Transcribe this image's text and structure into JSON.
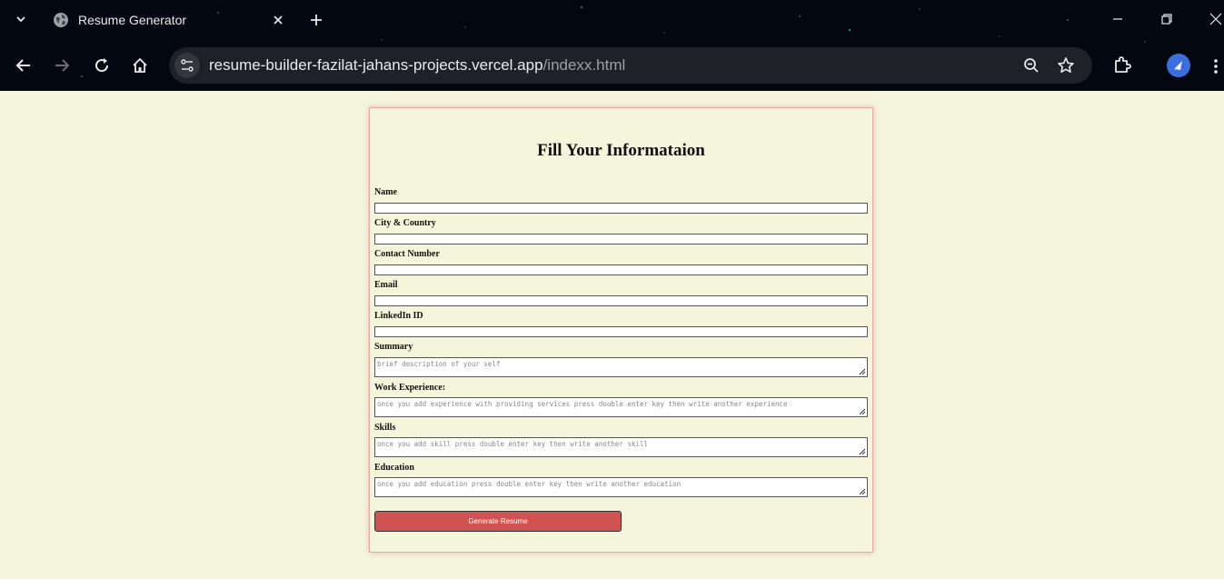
{
  "browser": {
    "tab_title": "Resume Generator",
    "url_host": "resume-builder-fazilat-jahans-projects.vercel.app",
    "url_path": "/indexx.html"
  },
  "form": {
    "heading": "Fill Your Informataion",
    "fields": [
      {
        "label": "Name"
      },
      {
        "label": "City & Country"
      },
      {
        "label": "Contact Number"
      },
      {
        "label": "Email"
      },
      {
        "label": "LinkedIn ID"
      }
    ],
    "textareas": [
      {
        "label": "Summary",
        "placeholder": "brief description of your self"
      },
      {
        "label": "Work Experience:",
        "placeholder": "once you add experience with providing services press double enter key then write another experience"
      },
      {
        "label": "Skills",
        "placeholder": "once you add skill press double enter key then write another skill"
      },
      {
        "label": "Education",
        "placeholder": "once you add education press double enter key then write another education"
      }
    ],
    "submit_label": "Generate Resume"
  },
  "colors": {
    "page_background": "#f5f5dc",
    "button": "#d05352",
    "chrome": "#03070f"
  }
}
